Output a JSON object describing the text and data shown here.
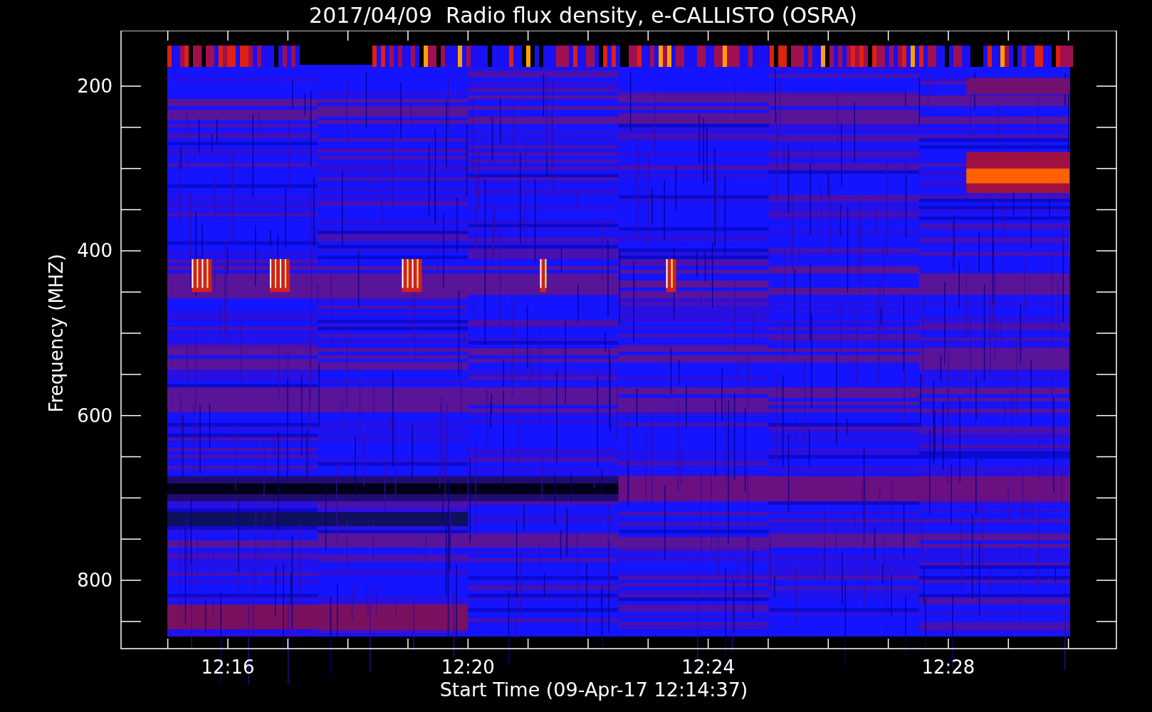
{
  "title": "2017/04/09  Radio flux density, e-CALLISTO (OSRA)",
  "y_axis": {
    "label": "Frequency (MHZ)",
    "ticks": [
      "200",
      "400",
      "600",
      "800"
    ]
  },
  "x_axis": {
    "label": "Start Time (09-Apr-17 12:14:37)",
    "ticks": [
      "12:16",
      "12:20",
      "12:24",
      "12:28"
    ]
  }
}
